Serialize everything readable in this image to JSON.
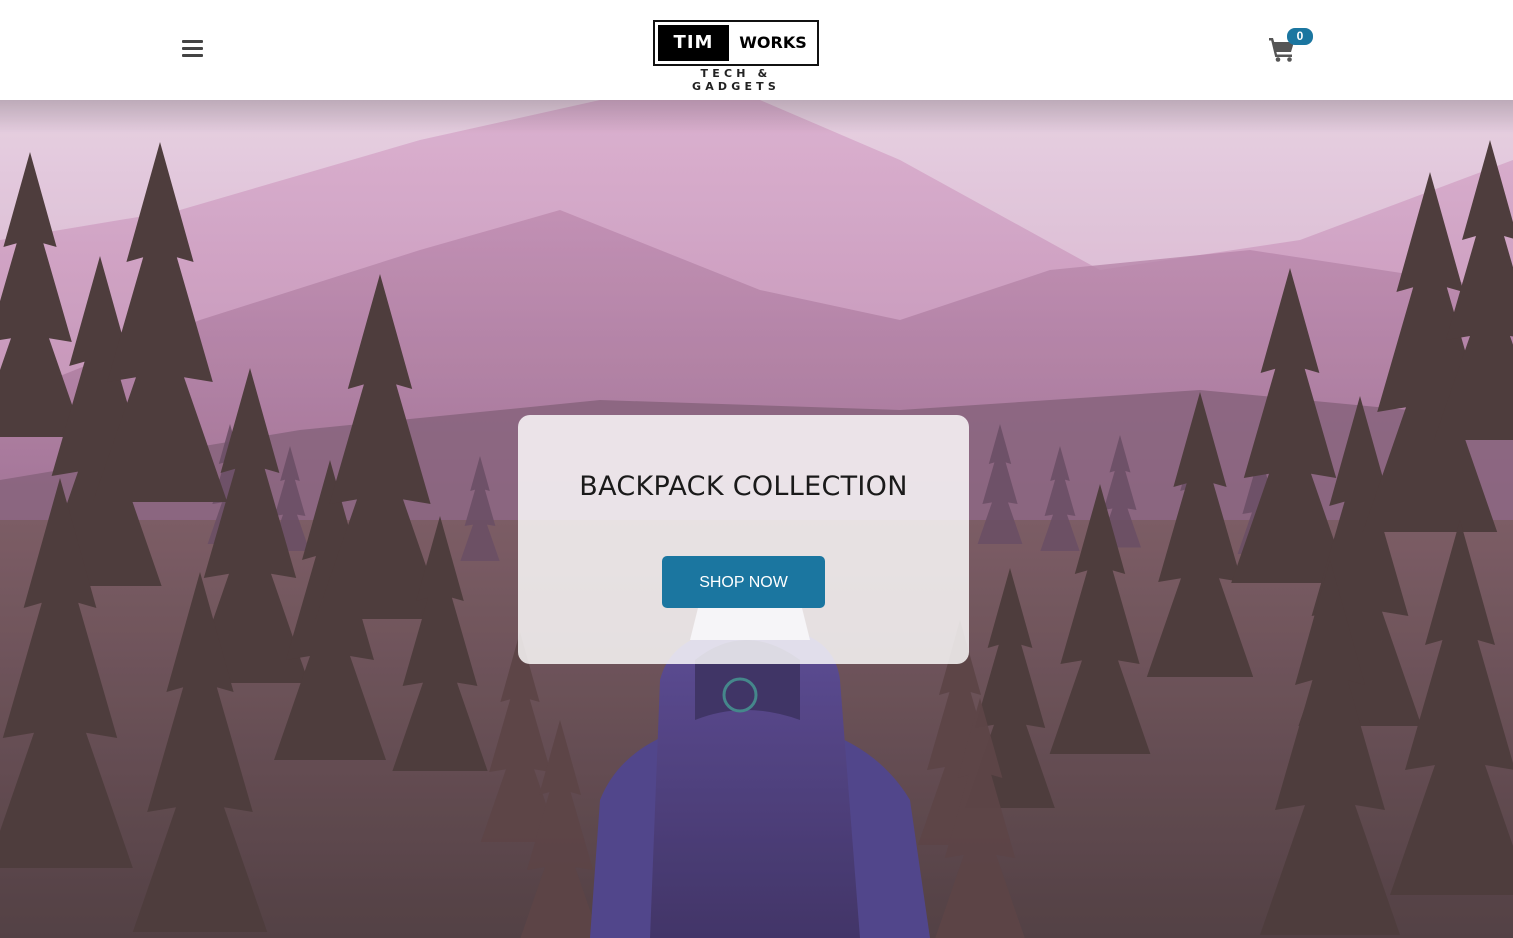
{
  "header": {
    "menu_label": "Menu",
    "logo": {
      "left_word": "TIM",
      "right_word": "WORKS",
      "tagline": "TECH & GADGETS"
    },
    "cart": {
      "icon": "shopping-cart-icon",
      "count": "0"
    }
  },
  "hero": {
    "image_description_icon": "mountain-forest-hiker-photo",
    "title": "BACKPACK COLLECTION",
    "button_label": "SHOP NOW"
  },
  "colors": {
    "accent": "#1b76a0",
    "nav_background": "#ffffff",
    "menu_icon": "#444444"
  }
}
